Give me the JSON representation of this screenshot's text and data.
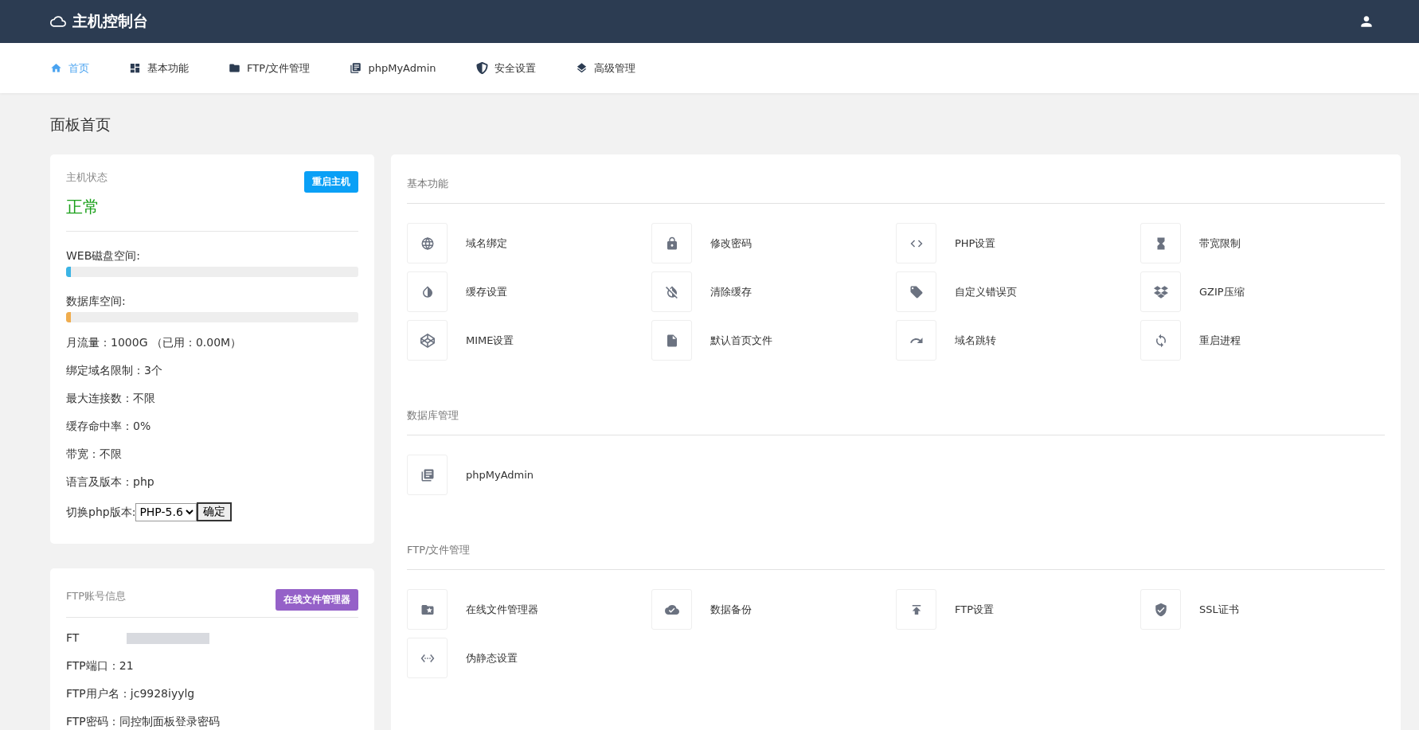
{
  "header": {
    "title": "主机控制台"
  },
  "nav": [
    {
      "label": "首页",
      "kind": "home",
      "selected": true
    },
    {
      "label": "基本功能",
      "kind": "dashboard",
      "selected": false
    },
    {
      "label": "FTP/文件管理",
      "kind": "folder",
      "selected": false
    },
    {
      "label": "phpMyAdmin",
      "kind": "books",
      "selected": false
    },
    {
      "label": "安全设置",
      "kind": "shield",
      "selected": false
    },
    {
      "label": "高级管理",
      "kind": "layers",
      "selected": false
    }
  ],
  "page_title": "面板首页",
  "host_card": {
    "title": "主机状态",
    "button": "重启主机",
    "status": "正常",
    "meters": [
      {
        "label": "WEB磁盘空间:",
        "level": 0.015,
        "color": "#3bb4e5"
      },
      {
        "label": "数据库空间:",
        "level": 0.015,
        "color": "#f0ad4e"
      }
    ],
    "lines": [
      "月流量：1000G （已用：0.00M）",
      "绑定域名限制：3个",
      "最大连接数：不限",
      "缓存命中率：0%",
      "带宽：不限",
      "语言及版本：php"
    ],
    "php_switch": {
      "label": "切换php版本:",
      "value": "PHP-5.6",
      "button": "确定"
    }
  },
  "ftp_card": {
    "title": "FTP账号信息",
    "button": "在线文件管理器",
    "lines": [
      {
        "text": "FT",
        "redacted": true
      },
      {
        "text": "FTP端口：21",
        "redacted": false
      },
      {
        "text": "FTP用户名：jc9928iyylg",
        "redacted": false
      },
      {
        "text": "FTP密码：同控制面板登录密码",
        "redacted": false
      }
    ]
  },
  "sections": [
    {
      "title": "基本功能",
      "items": [
        {
          "label": "域名绑定",
          "kind": "globe"
        },
        {
          "label": "修改密码",
          "kind": "lock"
        },
        {
          "label": "PHP设置",
          "kind": "code"
        },
        {
          "label": "带宽限制",
          "kind": "hourglass"
        },
        {
          "label": "缓存设置",
          "kind": "droplet"
        },
        {
          "label": "清除缓存",
          "kind": "nodrop"
        },
        {
          "label": "自定义错误页",
          "kind": "tag"
        },
        {
          "label": "GZIP压缩",
          "kind": "boxes"
        },
        {
          "label": "MIME设置",
          "kind": "cube"
        },
        {
          "label": "默认首页文件",
          "kind": "file"
        },
        {
          "label": "域名跳转",
          "kind": "redo"
        },
        {
          "label": "重启进程",
          "kind": "sync"
        }
      ]
    },
    {
      "title": "数据库管理",
      "items": [
        {
          "label": "phpMyAdmin",
          "kind": "books"
        }
      ]
    },
    {
      "title": "FTP/文件管理",
      "items": [
        {
          "label": "在线文件管理器",
          "kind": "folderstar"
        },
        {
          "label": "数据备份",
          "kind": "clouddone"
        },
        {
          "label": "FTP设置",
          "kind": "upload"
        },
        {
          "label": "SSL证书",
          "kind": "shieldcheck"
        },
        {
          "label": "伪静态设置",
          "kind": "ethernet"
        }
      ]
    }
  ]
}
